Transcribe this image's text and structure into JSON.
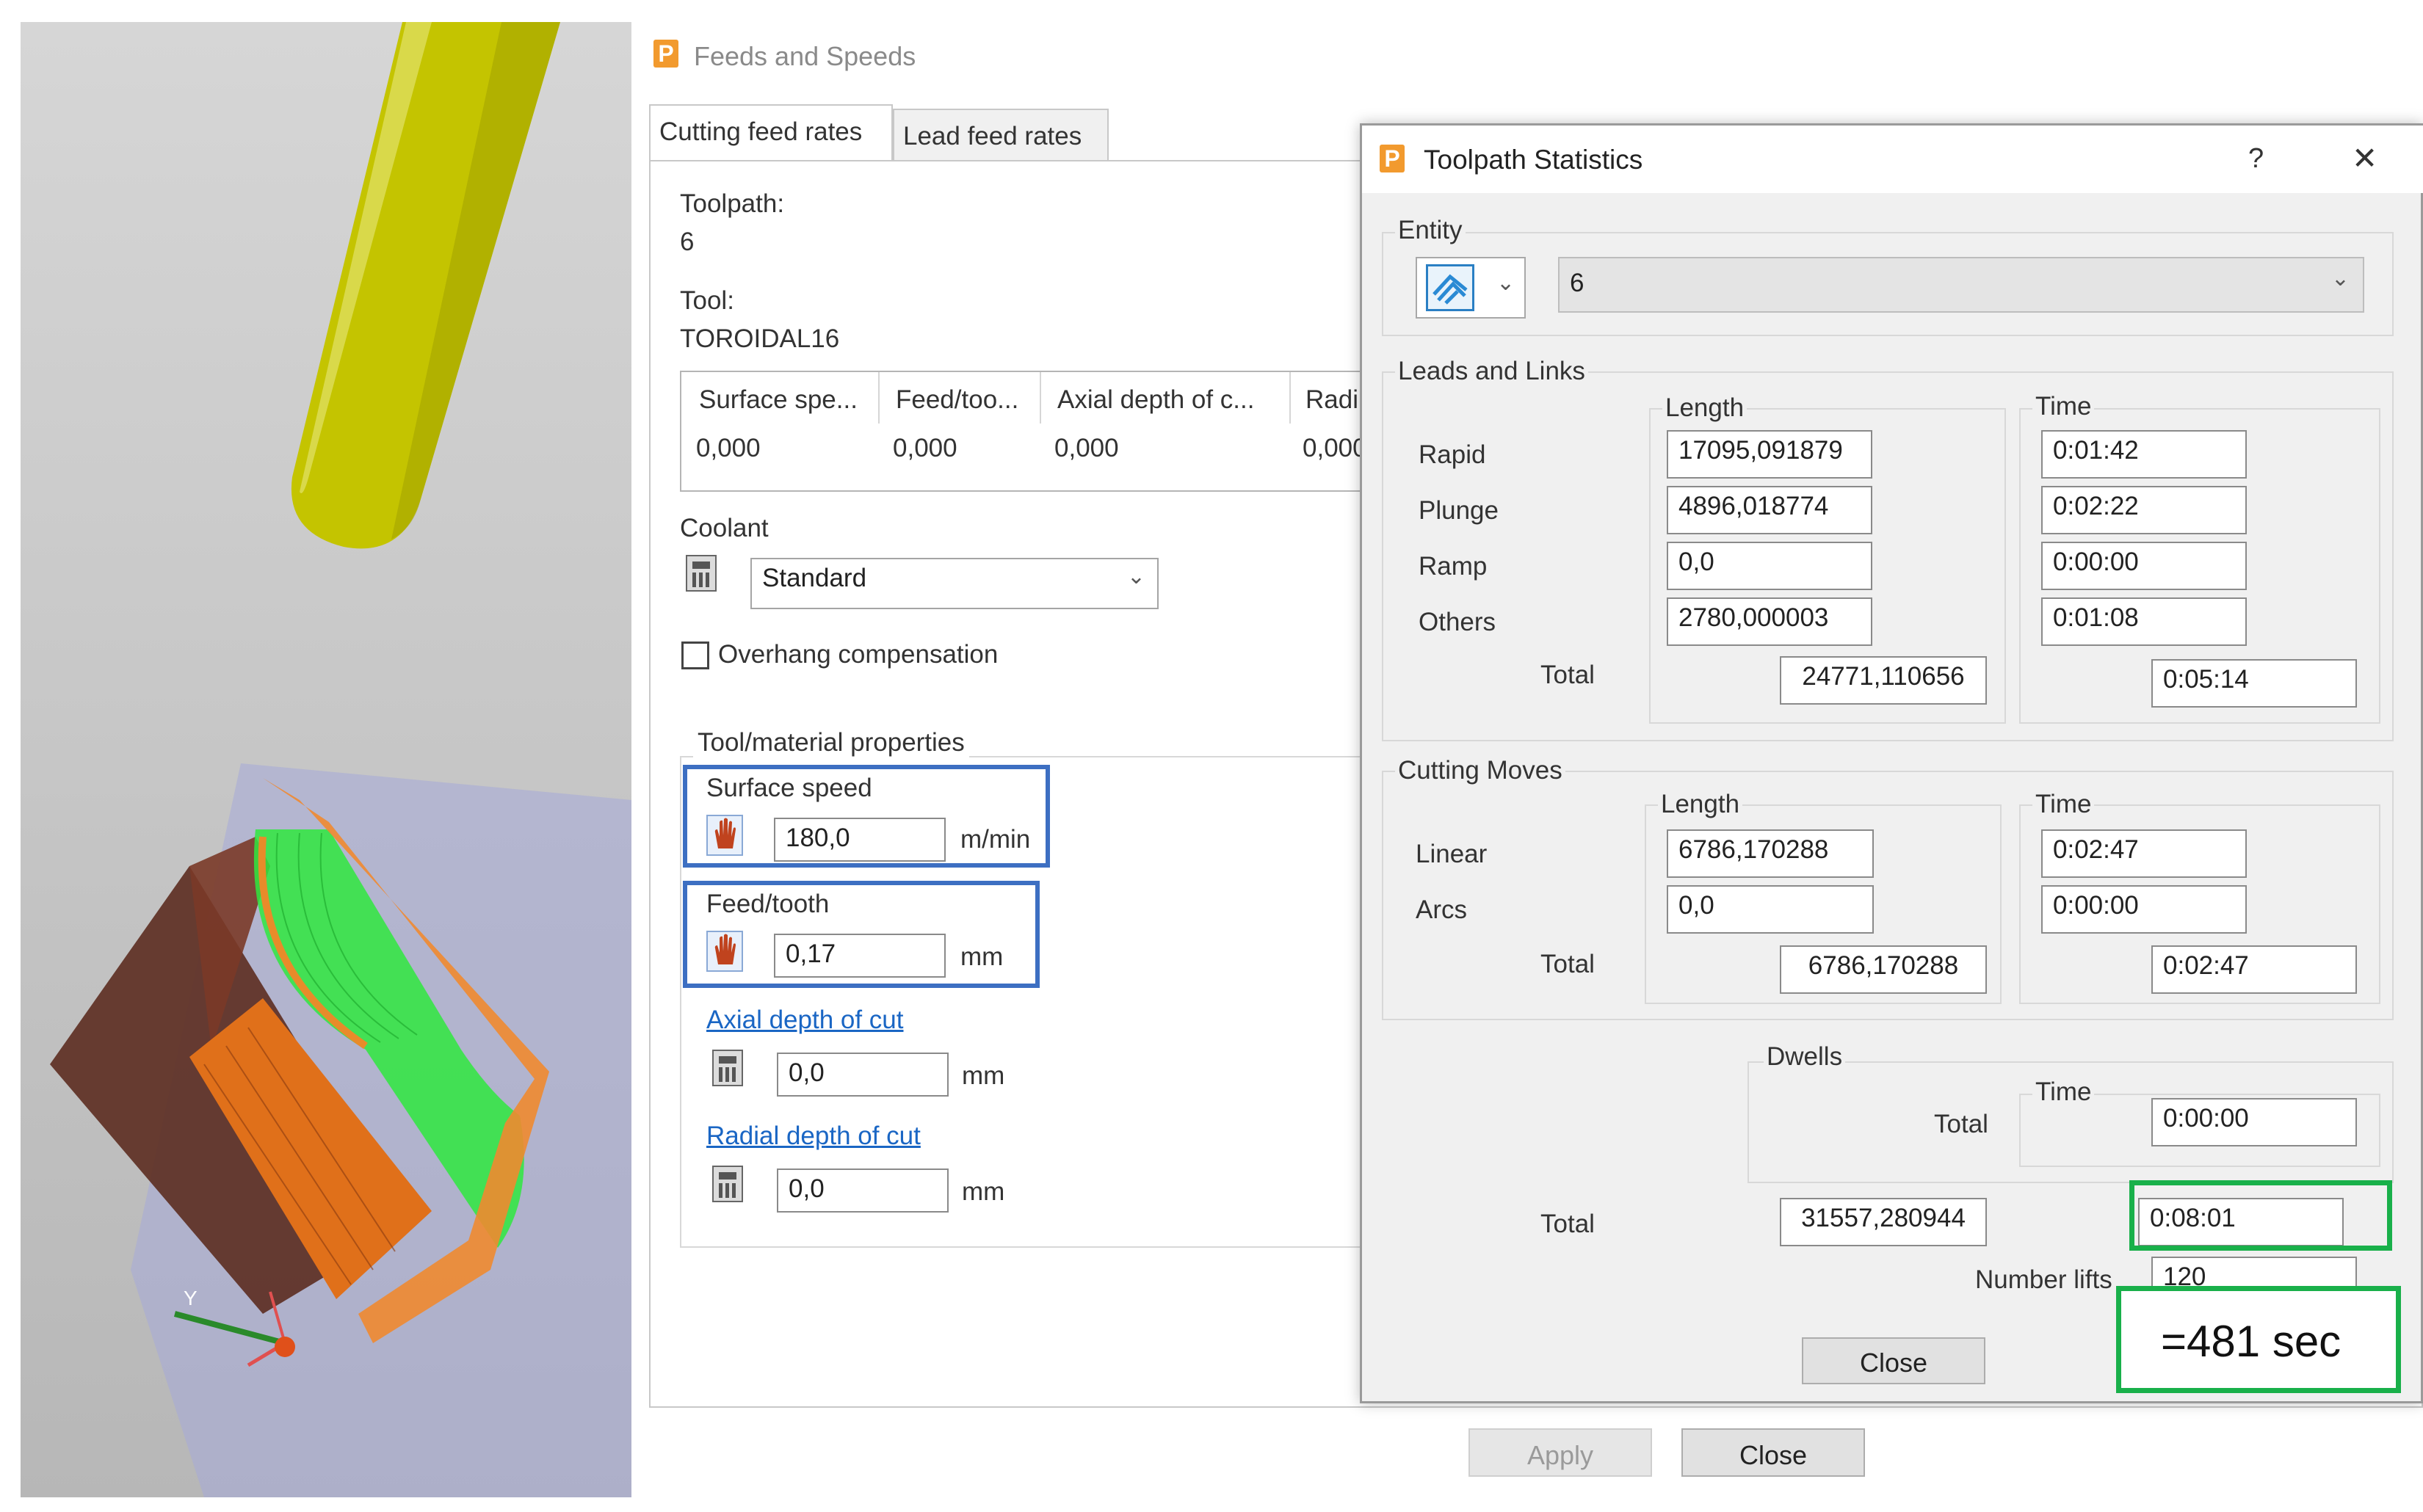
{
  "feeds_dialog": {
    "title": "Feeds and Speeds",
    "tabs": [
      "Cutting feed rates",
      "Lead feed rates"
    ],
    "toolpath_label": "Toolpath:",
    "toolpath_value": "6",
    "tool_label": "Tool:",
    "tool_value": "TOROIDAL16",
    "table_headers": [
      "Surface spe...",
      "Feed/too...",
      "Axial depth of c...",
      "Radi"
    ],
    "table_values": [
      "0,000",
      "0,000",
      "0,000",
      "0,000"
    ],
    "coolant_label": "Coolant",
    "coolant_value": "Standard",
    "overhang_label": "Overhang compensation",
    "props_label": "Tool/material properties",
    "surface_speed_label": "Surface speed",
    "surface_speed_value": "180,0",
    "surface_speed_unit": "m/min",
    "feed_tooth_label": "Feed/tooth",
    "feed_tooth_value": "0,17",
    "feed_tooth_unit": "mm",
    "axial_link": "Axial depth of cut",
    "axial_value": "0,0",
    "axial_unit": "mm",
    "radial_link": "Radial depth of cut",
    "radial_value": "0,0",
    "radial_unit": "mm",
    "apply_button": "Apply",
    "close_button": "Close"
  },
  "stats_dialog": {
    "title": "Toolpath Statistics",
    "help": "?",
    "close_x": "✕",
    "entity_label": "Entity",
    "entity_value": "6",
    "leads_label": "Leads and Links",
    "length_header": "Length",
    "time_header": "Time",
    "leads_rows": [
      {
        "label": "Rapid",
        "length": "17095,091879",
        "time": "0:01:42"
      },
      {
        "label": "Plunge",
        "length": "4896,018774",
        "time": "0:02:22"
      },
      {
        "label": "Ramp",
        "length": "0,0",
        "time": "0:00:00"
      },
      {
        "label": "Others",
        "length": "2780,000003",
        "time": "0:01:08"
      }
    ],
    "leads_total_label": "Total",
    "leads_total_length": "24771,110656",
    "leads_total_time": "0:05:14",
    "cutting_label": "Cutting Moves",
    "cutting_rows": [
      {
        "label": "Linear",
        "length": "6786,170288",
        "time": "0:02:47"
      },
      {
        "label": "Arcs",
        "length": "0,0",
        "time": "0:00:00"
      }
    ],
    "cutting_total_label": "Total",
    "cutting_total_length": "6786,170288",
    "cutting_total_time": "0:02:47",
    "dwells_label": "Dwells",
    "dwells_time_header": "Time",
    "dwells_total_label": "Total",
    "dwells_total_time": "0:00:00",
    "grand_total_label": "Total",
    "grand_total_length": "31557,280944",
    "grand_total_time": "0:08:01",
    "lifts_label": "Number lifts",
    "lifts_value": "120",
    "close_button": "Close"
  },
  "annotation": "=481 sec",
  "viewport_axis_label": "Y",
  "colors": {
    "blue_highlight": "#3d6fc2",
    "green_highlight": "#19b04a",
    "app_accent": "#f29a2e",
    "tool_color": "#c2c200",
    "toolpath_green": "#33ee44",
    "stock_orange": "#ee8833"
  }
}
